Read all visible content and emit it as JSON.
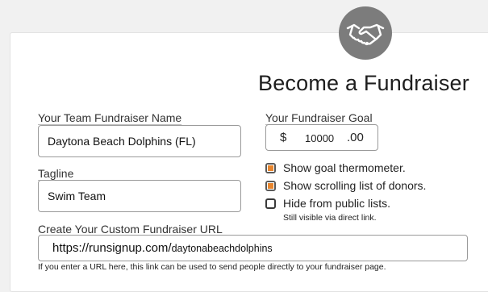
{
  "page": {
    "title": "Become a Fundraiser",
    "icon": "handshake-icon"
  },
  "team_name": {
    "label": "Your Team Fundraiser Name",
    "value": "Daytona Beach Dolphins (FL)"
  },
  "goal": {
    "label": "Your Fundraiser Goal",
    "currency": "$",
    "amount": "10000",
    "cents": ".00"
  },
  "tagline": {
    "label": "Tagline",
    "value": "Swim Team"
  },
  "options": [
    {
      "label": "Show goal thermometer.",
      "checked": true
    },
    {
      "label": "Show scrolling list of donors.",
      "checked": true
    },
    {
      "label": "Hide from public lists.",
      "checked": false,
      "note": "Still visible via direct link."
    }
  ],
  "custom_url": {
    "label": "Create Your Custom Fundraiser URL",
    "prefix": "https://runsignup.com/",
    "slug": "daytonabeachdolphins",
    "help": "If you enter a URL here, this link can be used to send people directly to your fundraiser page."
  },
  "colors": {
    "checkbox_accent": "#e8852d",
    "icon_circle": "#7c7c7c"
  }
}
